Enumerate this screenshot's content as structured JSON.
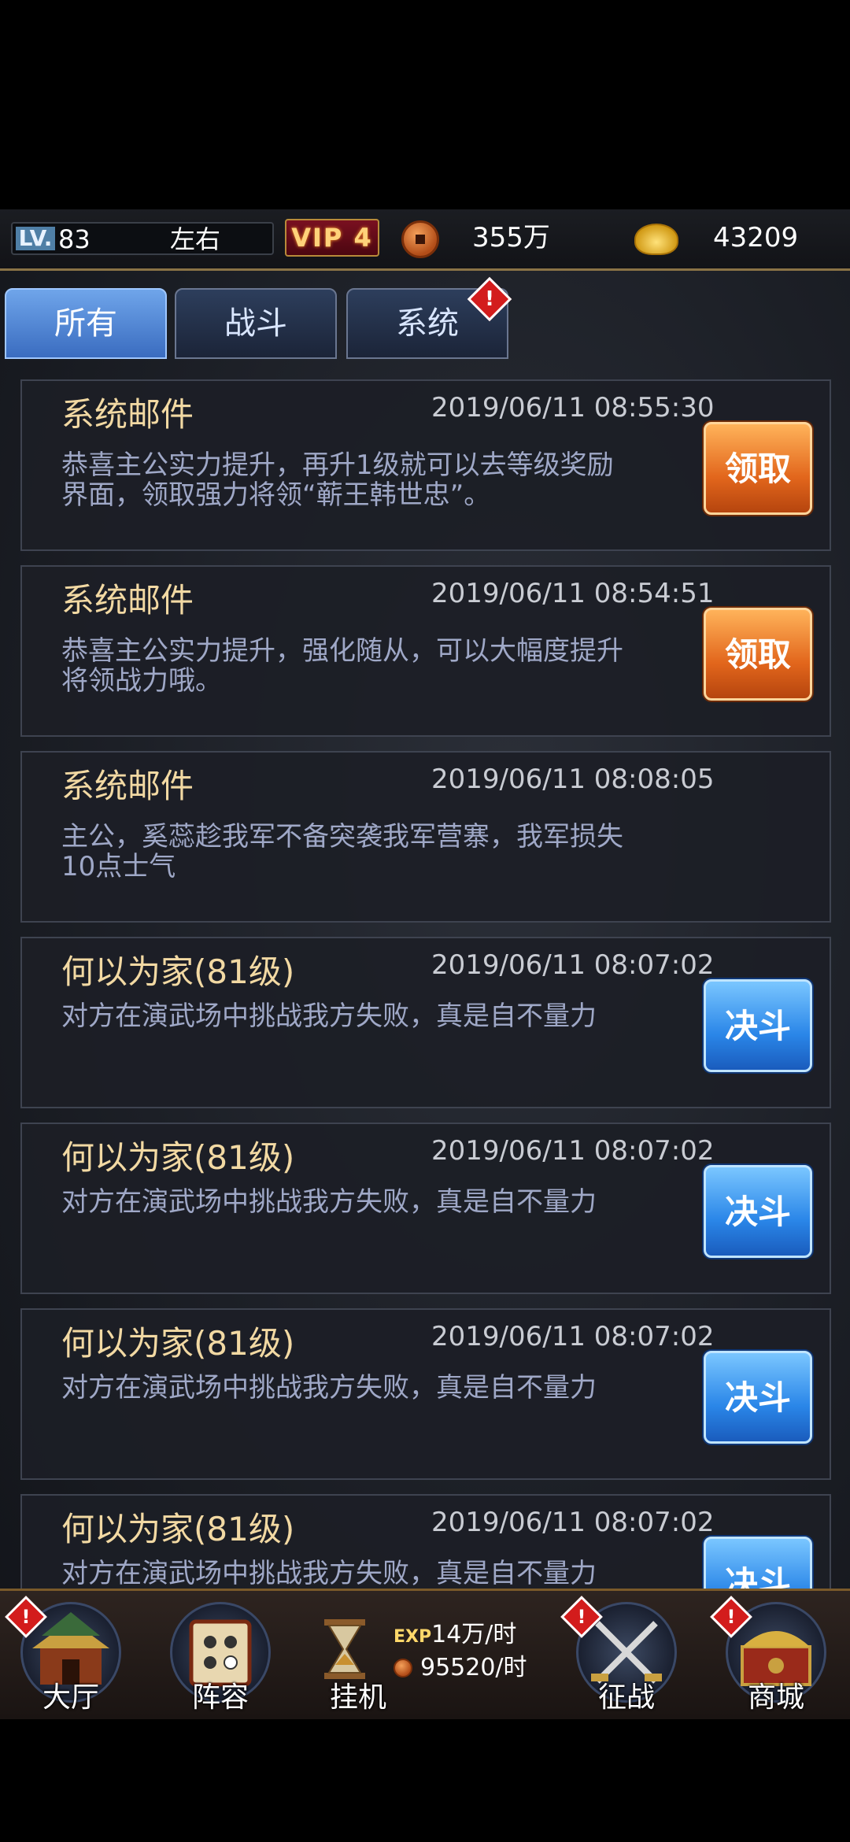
{
  "topbar": {
    "lv_tag": "LV.",
    "level": "83",
    "player_name": "左右",
    "vip": "VIP 4",
    "coins": "355万",
    "gold": "43209",
    "icons": {
      "coin": "copper-coin-icon",
      "gold": "gold-ingot-icon"
    }
  },
  "tabs": [
    {
      "label": "所有",
      "active": true
    },
    {
      "label": "战斗",
      "active": false
    },
    {
      "label": "系统",
      "active": false,
      "alert": "!"
    }
  ],
  "mails": [
    {
      "title": "系统邮件",
      "time": "2019/06/11 08:55:30",
      "body_lines": [
        "恭喜主公实力提升，再升1级就可以去等级奖励",
        "界面，领取强力将领“蕲王韩世忠”。"
      ],
      "action": "领取",
      "action_type": "claim"
    },
    {
      "title": "系统邮件",
      "time": "2019/06/11 08:54:51",
      "body_lines": [
        "恭喜主公实力提升，强化随从，可以大幅度提升",
        "将领战力哦。"
      ],
      "action": "领取",
      "action_type": "claim"
    },
    {
      "title": "系统邮件",
      "time": "2019/06/11 08:08:05",
      "body_lines": [
        "主公，奚蕊趁我军不备突袭我军营寨，我军损失",
        "10点士气"
      ],
      "action": "",
      "action_type": "none"
    },
    {
      "title": "何以为家(81级)",
      "time": "2019/06/11 08:07:02",
      "body_lines": [
        "对方在演武场中挑战我方失败，真是自不量力",
        ""
      ],
      "action": "决斗",
      "action_type": "duel"
    },
    {
      "title": "何以为家(81级)",
      "time": "2019/06/11 08:07:02",
      "body_lines": [
        "对方在演武场中挑战我方失败，真是自不量力",
        ""
      ],
      "action": "决斗",
      "action_type": "duel"
    },
    {
      "title": "何以为家(81级)",
      "time": "2019/06/11 08:07:02",
      "body_lines": [
        "对方在演武场中挑战我方失败，真是自不量力",
        ""
      ],
      "action": "决斗",
      "action_type": "duel"
    },
    {
      "title": "何以为家(81级)",
      "time": "2019/06/11 08:07:02",
      "body_lines": [
        "对方在演武场中挑战我方失败，真是自不量力",
        ""
      ],
      "action": "决斗",
      "action_type": "duel"
    }
  ],
  "bottomnav": {
    "items": [
      {
        "label": "大厅",
        "icon": "palace-icon",
        "alert": "!"
      },
      {
        "label": "阵容",
        "icon": "scroll-formation-icon",
        "alert": ""
      },
      {
        "label": "挂机",
        "icon": "hourglass-icon",
        "alert": ""
      },
      {
        "label": "征战",
        "icon": "crossed-swords-icon",
        "alert": "!"
      },
      {
        "label": "商城",
        "icon": "treasure-chest-icon",
        "alert": "!"
      }
    ],
    "exp_tag": "EXP",
    "exp_rate": "14万/时",
    "coin_rate": "95520/时"
  },
  "colors": {
    "accent_gold": "#f2d9a3",
    "claim_button": "#e2661c",
    "duel_button": "#2a86e8",
    "alert_red": "#d31c1c"
  }
}
